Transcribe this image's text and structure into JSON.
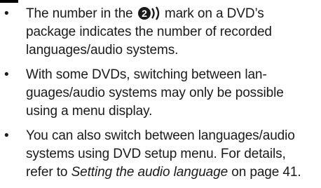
{
  "notes": {
    "items": [
      {
        "lines": [
          {
            "before": "The number in the ",
            "mark_number": "2",
            "after": " mark on a DVD’s"
          },
          {
            "text": "package indicates the number of recorded"
          },
          {
            "text": "languages/audio systems."
          }
        ]
      },
      {
        "lines": [
          {
            "text": "With some DVDs, switching between lan-"
          },
          {
            "text": "guages/audio systems may only be possible"
          },
          {
            "text": "using a menu display."
          }
        ]
      },
      {
        "lines": [
          {
            "text": "You can also switch between languages/audio"
          },
          {
            "text": "systems using DVD setup menu. For details,"
          },
          {
            "before": "refer to ",
            "link": "Setting the audio language",
            "after": " on page 41."
          }
        ]
      }
    ]
  }
}
